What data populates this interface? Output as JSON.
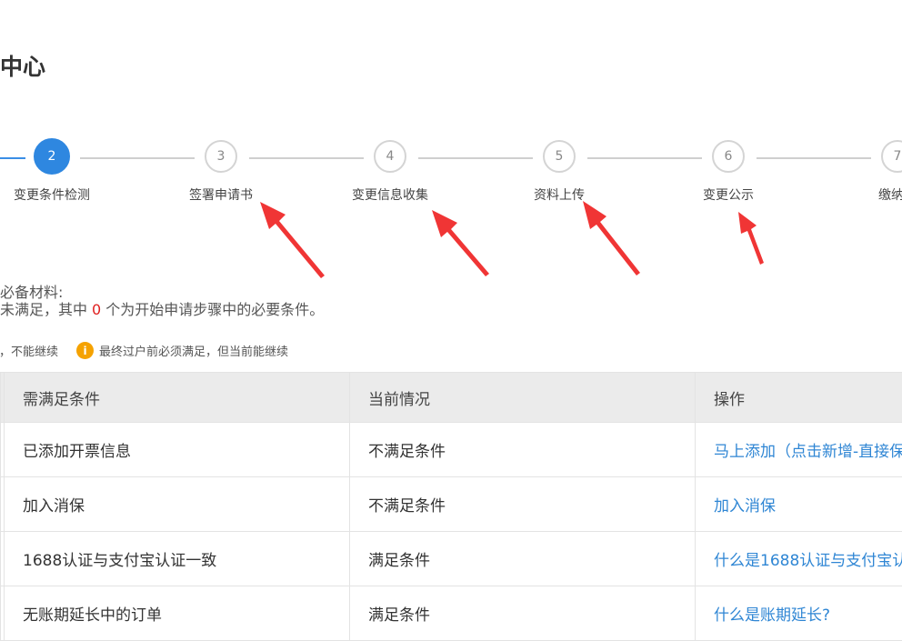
{
  "page": {
    "title": "中心"
  },
  "stepper": {
    "steps": [
      {
        "num": "2",
        "label": "变更条件检测",
        "active": true
      },
      {
        "num": "3",
        "label": "签署申请书"
      },
      {
        "num": "4",
        "label": "变更信息收集"
      },
      {
        "num": "5",
        "label": "资料上传"
      },
      {
        "num": "6",
        "label": "变更公示"
      },
      {
        "num": "7",
        "label": "缴纳服"
      }
    ]
  },
  "info": {
    "line1": "家必备材料:",
    "line2_prefix": "件未满足，其中",
    "line2_count": "0",
    "line2_suffix": "个为开始申请步骤中的必要条件。"
  },
  "legend": {
    "blocking": "足，不能继续",
    "warning_icon": "i",
    "warning": "最终过户前必须满足，但当前能继续",
    "warning_color": "#f5a200"
  },
  "table": {
    "headers": [
      "需满足条件",
      "当前情况",
      "操作"
    ],
    "rows": [
      {
        "condition": "已添加开票信息",
        "status": "不满足条件",
        "action": "马上添加（点击新增-直接保"
      },
      {
        "condition": "加入消保",
        "status": "不满足条件",
        "action": "加入消保"
      },
      {
        "condition": "1688认证与支付宝认证一致",
        "status": "满足条件",
        "action": "什么是1688认证与支付宝认"
      },
      {
        "condition": "无账期延长中的订单",
        "status": "满足条件",
        "action": "什么是账期延长?"
      }
    ]
  },
  "colors": {
    "accent": "#2e87e0",
    "link": "#2f86d4",
    "alert": "#e02020",
    "arrow": "#f03535"
  }
}
